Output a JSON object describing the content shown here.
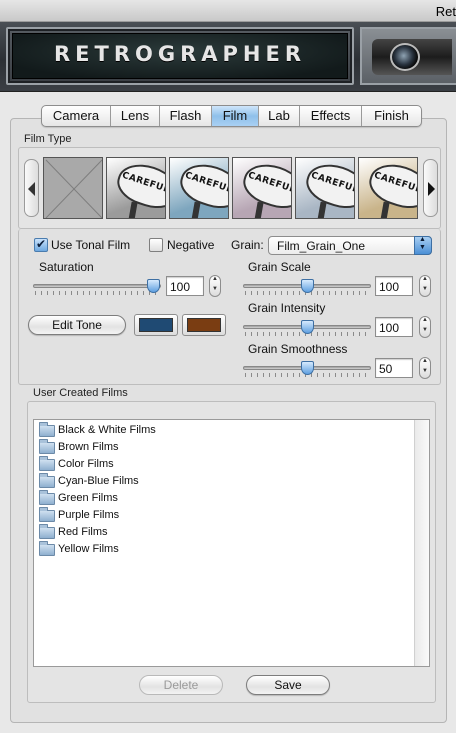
{
  "window": {
    "title": "Ret"
  },
  "banner": {
    "logo_text": "RETROGRAPHER"
  },
  "tabs": [
    {
      "label": "Camera",
      "active": false
    },
    {
      "label": "Lens",
      "active": false
    },
    {
      "label": "Flash",
      "active": false
    },
    {
      "label": "Film",
      "active": true
    },
    {
      "label": "Lab",
      "active": false
    },
    {
      "label": "Effects",
      "active": false
    },
    {
      "label": "Finish",
      "active": false
    }
  ],
  "film_type": {
    "heading": "Film Type",
    "thumbnails": [
      {
        "kind": "empty"
      },
      {
        "kind": "preset",
        "sign_text": "CAREFUL",
        "tint": "#9b9b9b"
      },
      {
        "kind": "preset",
        "sign_text": "CAREFUL",
        "tint": "#7ea6be"
      },
      {
        "kind": "preset",
        "sign_text": "CAREFUL",
        "tint": "#b7a6b4"
      },
      {
        "kind": "preset",
        "sign_text": "CAREFUL",
        "tint": "#a9b6c4"
      },
      {
        "kind": "preset",
        "sign_text": "CAREFUL",
        "tint": "#c9b48a"
      }
    ]
  },
  "tonal": {
    "use_tonal_film_label": "Use Tonal Film",
    "use_tonal_film_checked": true,
    "negative_label": "Negative",
    "negative_checked": false,
    "saturation_label": "Saturation",
    "saturation_value": "100",
    "saturation_fraction": 0.94,
    "edit_tone_label": "Edit Tone",
    "tone_color_1": "#1f4a73",
    "tone_color_2": "#7a3d12"
  },
  "grain": {
    "label": "Grain:",
    "selected": "Film_Grain_One",
    "scale_label": "Grain Scale",
    "scale_value": "100",
    "scale_fraction": 0.5,
    "intensity_label": "Grain Intensity",
    "intensity_value": "100",
    "intensity_fraction": 0.5,
    "smoothness_label": "Grain Smoothness",
    "smoothness_value": "50",
    "smoothness_fraction": 0.5
  },
  "user_films": {
    "heading": "User Created Films",
    "items": [
      "Black & White Films",
      "Brown Films",
      "Color Films",
      "Cyan-Blue Films",
      "Green Films",
      "Purple Films",
      "Red Films",
      "Yellow Films"
    ],
    "delete_label": "Delete",
    "save_label": "Save"
  }
}
